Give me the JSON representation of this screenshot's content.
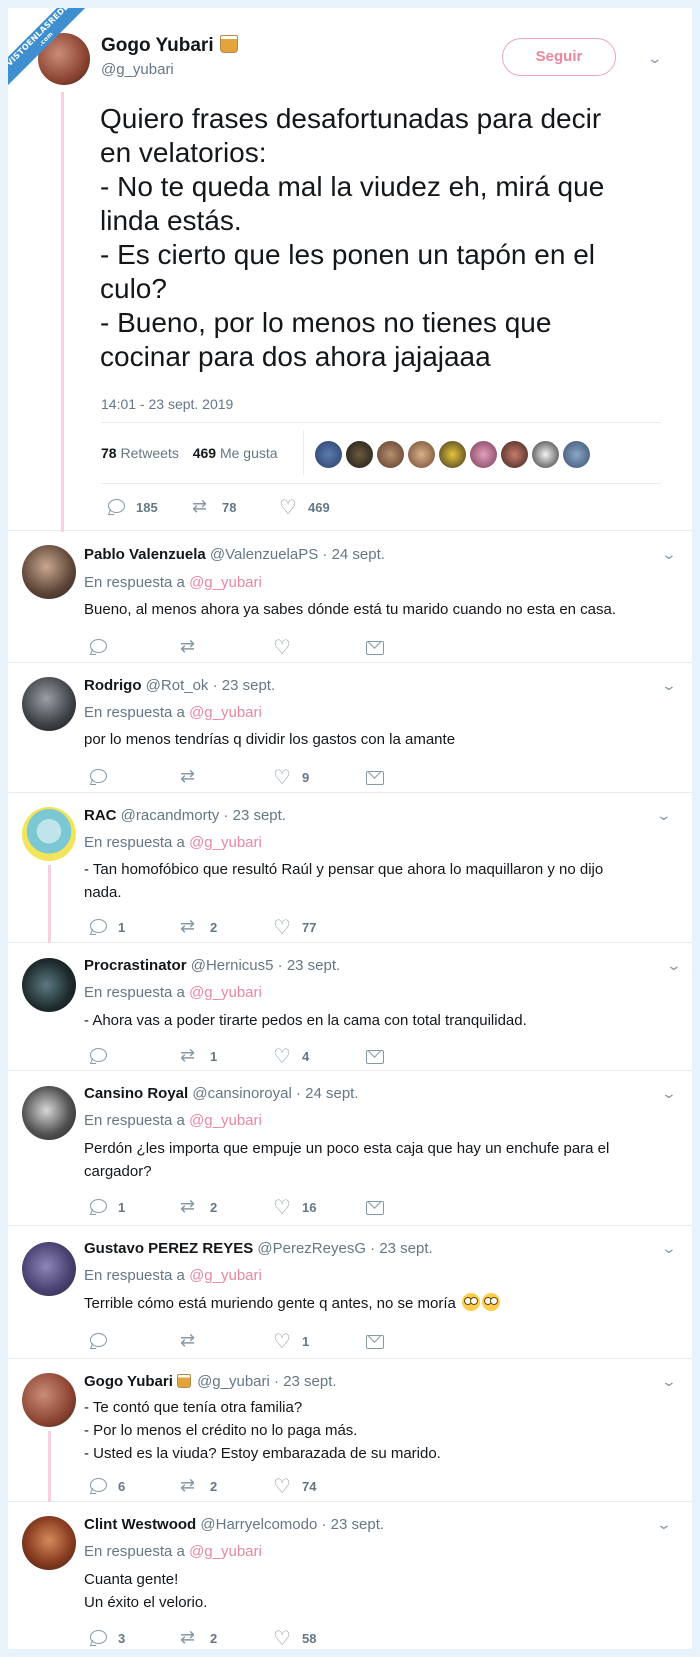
{
  "watermark": {
    "line1": "VISTOENLASREDES",
    "line2": ".com"
  },
  "main_tweet": {
    "author_name": "Gogo Yubari",
    "author_emoji": "beer-mug-icon",
    "author_handle": "@g_yubari",
    "follow_label": "Seguir",
    "text": "Quiero frases desafortunadas para decir\nen velatorios:\n- No te queda mal la viudez eh, mirá que\nlinda estás.\n- Es cierto que les ponen un tapón en el\nculo?\n- Bueno, por lo menos no tienes que\ncocinar para dos ahora jajajaaa",
    "timestamp": "14:01 - 23 sept. 2019",
    "retweets_count": "78",
    "retweets_label": "Retweets",
    "likes_count": "469",
    "likes_label": "Me gusta",
    "actions": {
      "replies": "185",
      "retweets": "78",
      "likes": "469"
    }
  },
  "in_reply_label": "En respuesta a",
  "in_reply_handle": "@g_yubari",
  "replies": [
    {
      "name": "Pablo Valenzuela",
      "handle": "@ValenzuelaPS",
      "date": "· 24 sept.",
      "text": "Bueno, al menos ahora ya sabes dónde está tu marido cuando no esta en casa.",
      "replies": "",
      "retweets": "",
      "likes": ""
    },
    {
      "name": "Rodrigo",
      "handle": "@Rot_ok",
      "date": "· 23 sept.",
      "text": "por lo menos tendrías q dividir los gastos con la amante",
      "replies": "",
      "retweets": "",
      "likes": "9"
    },
    {
      "name": "RAC",
      "handle": "@racandmorty",
      "date": "· 23 sept.",
      "text": "- Tan homofóbico que resultó Raúl y pensar que ahora lo maquillaron y no dijo\nnada.",
      "replies": "1",
      "retweets": "2",
      "likes": "77"
    },
    {
      "name": "Procrastinator",
      "handle": "@Hernicus5",
      "date": "· 23 sept.",
      "text": "- Ahora vas a poder tirarte pedos en la cama con total tranquilidad.",
      "replies": "",
      "retweets": "1",
      "likes": "4"
    },
    {
      "name": "Cansino Royal",
      "handle": "@cansinoroyal",
      "date": "· 24 sept.",
      "text": "Perdón ¿les importa que empuje un poco esta caja que hay un enchufe para el\ncargador?",
      "replies": "1",
      "retweets": "2",
      "likes": "16"
    },
    {
      "name": "Gustavo PEREZ REYES",
      "handle": "@PerezReyesG",
      "date": "· 23 sept.",
      "text": "Terrible cómo está muriendo gente q antes, no se moría",
      "replies": "",
      "retweets": "",
      "likes": "1"
    },
    {
      "name": "Gogo Yubari",
      "handle": "@g_yubari",
      "date": "· 23 sept.",
      "text": "- Te contó que tenía otra familia?\n- Por lo menos el crédito no lo paga más.\n- Usted es la viuda? Estoy embarazada de su marido.",
      "replies": "6",
      "retweets": "2",
      "likes": "74"
    },
    {
      "name": "Clint Westwood",
      "handle": "@Harryelcomodo",
      "date": "· 23 sept.",
      "text": "Cuanta gente!\nUn éxito el velorio.",
      "replies": "3",
      "retweets": "2",
      "likes": "58"
    }
  ],
  "colors": {
    "accent_pink": "#e8889f",
    "thread_line": "#f6d0da",
    "muted": "#657786",
    "frame_bg": "#e8f2fb"
  }
}
